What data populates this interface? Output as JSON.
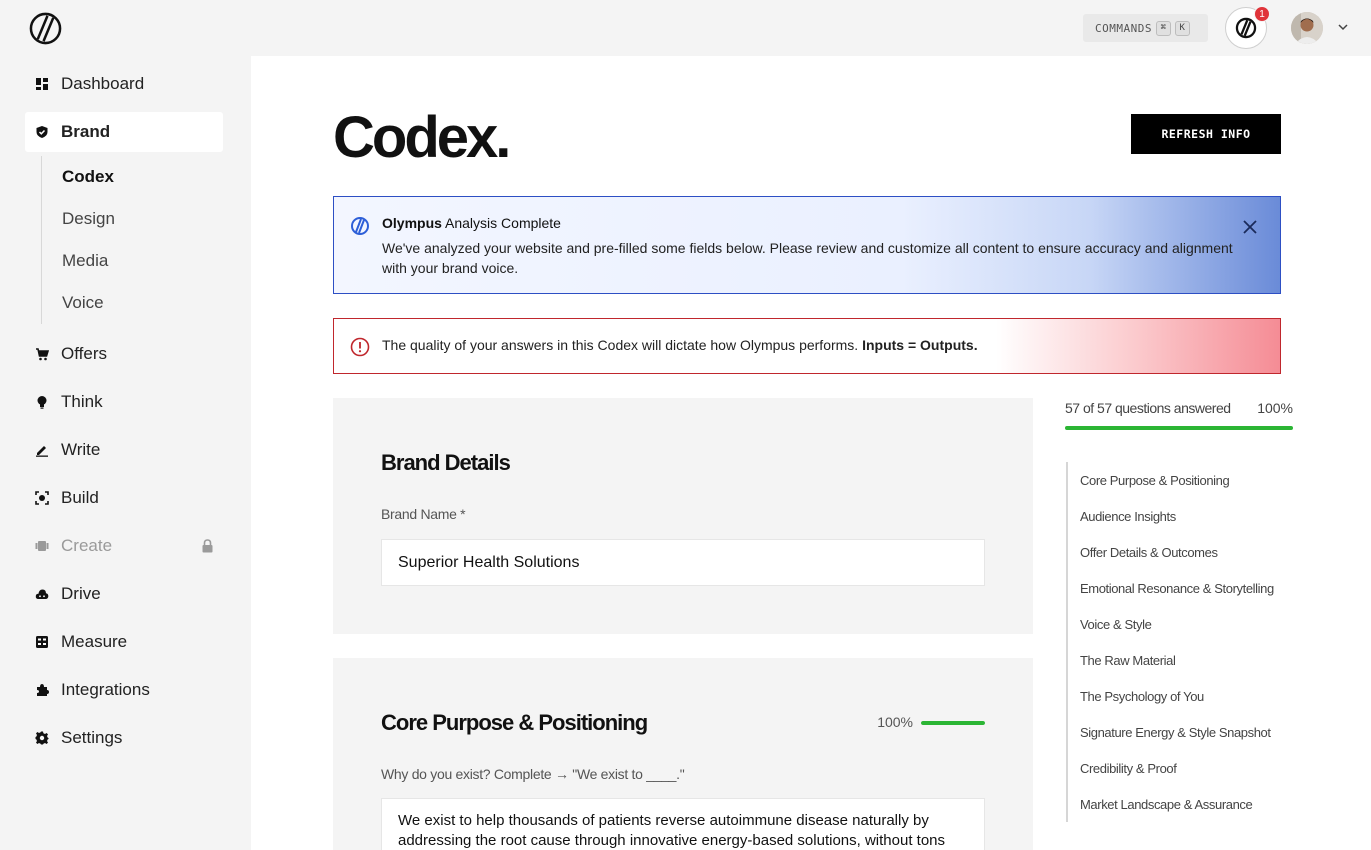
{
  "topbar": {
    "commands_label": "COMMANDS",
    "shortcut_keys": [
      "⌘",
      "K"
    ],
    "notification_count": "1"
  },
  "sidebar": {
    "items": [
      {
        "label": "Dashboard",
        "icon": "dashboard-icon"
      },
      {
        "label": "Brand",
        "icon": "shield-icon",
        "active": true,
        "children": [
          "Codex",
          "Design",
          "Media",
          "Voice"
        ],
        "active_child": "Codex"
      },
      {
        "label": "Offers",
        "icon": "cart-icon"
      },
      {
        "label": "Think",
        "icon": "bulb-icon"
      },
      {
        "label": "Write",
        "icon": "pen-icon"
      },
      {
        "label": "Build",
        "icon": "build-icon"
      },
      {
        "label": "Create",
        "icon": "create-icon",
        "disabled": true,
        "locked": true
      },
      {
        "label": "Drive",
        "icon": "cloud-icon"
      },
      {
        "label": "Measure",
        "icon": "grid-icon"
      },
      {
        "label": "Integrations",
        "icon": "puzzle-icon"
      },
      {
        "label": "Settings",
        "icon": "gear-icon"
      }
    ]
  },
  "page": {
    "title": "Codex.",
    "refresh_label": "REFRESH INFO"
  },
  "info_banner": {
    "title_bold": "Olympus",
    "title_rest": " Analysis Complete",
    "body": "We've analyzed your website and pre-filled some fields below. Please review and customize all content to ensure accuracy and alignment with your brand voice."
  },
  "warning_banner": {
    "text": "The quality of your answers in this Codex will dictate how Olympus performs. ",
    "bold": "Inputs = Outputs."
  },
  "brand_details": {
    "title": "Brand Details",
    "brand_name_label": "Brand Name *",
    "brand_name_value": "Superior Health Solutions"
  },
  "core_purpose": {
    "title": "Core Purpose & Positioning",
    "percent": "100%",
    "progress": 1.0,
    "question": "Why do you exist? Complete → \"We exist to ____.\"",
    "answer": "We exist to help thousands of patients reverse autoimmune disease naturally by addressing the root cause through innovative energy-based solutions, without tons"
  },
  "progress": {
    "label": "57 of 57 questions answered",
    "percent": "100%",
    "fraction": 1.0
  },
  "toc": [
    "Core Purpose & Positioning",
    "Audience Insights",
    "Offer Details & Outcomes",
    "Emotional Resonance & Storytelling",
    "Voice & Style",
    "The Raw Material",
    "The Psychology of You",
    "Signature Energy & Style Snapshot",
    "Credibility & Proof",
    "Market Landscape & Assurance"
  ],
  "colors": {
    "accent_green": "#2bb534",
    "info_border": "#2d4fc4",
    "warning_border": "#c0272d",
    "badge_red": "#e0343a"
  }
}
